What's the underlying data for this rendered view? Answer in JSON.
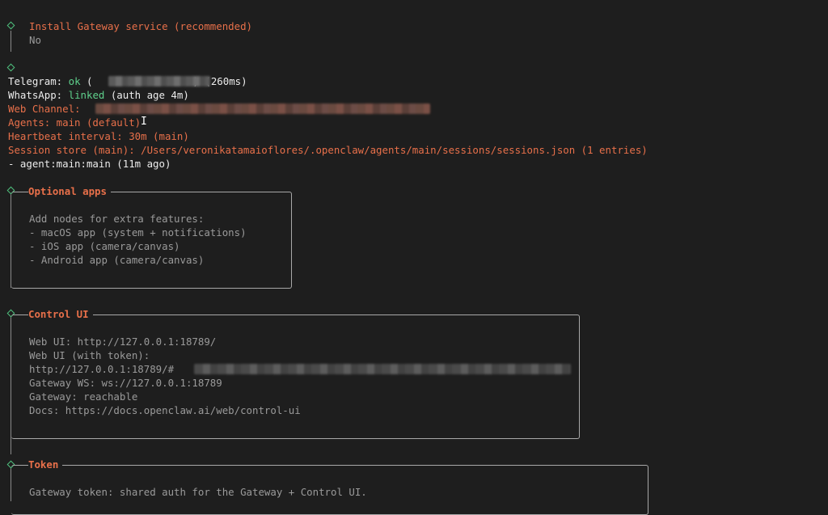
{
  "install": {
    "title": "Install Gateway service (recommended)",
    "value": "No"
  },
  "status": {
    "telegram_label": "Telegram: ",
    "telegram_status": "ok",
    "telegram_open": " (",
    "telegram_close": ") (260ms)",
    "whatsapp_label": "WhatsApp: ",
    "whatsapp_status": "linked",
    "whatsapp_detail": " (auth age 4m)",
    "web_channel": "Web Channel:",
    "agents": "Agents: main (default)",
    "heartbeat": "Heartbeat interval: 30m (main)",
    "session_store": "Session store (main): /Users/veronikatamaioflores/.openclaw/agents/main/sessions/sessions.json (1 entries)",
    "agent_line": "- agent:main:main (11m ago)"
  },
  "optional_apps": {
    "title": "Optional apps",
    "lines": [
      "Add nodes for extra features:",
      "- macOS app (system + notifications)",
      "- iOS app (camera/canvas)",
      "- Android app (camera/canvas)"
    ]
  },
  "control_ui": {
    "title": "Control UI",
    "lines": [
      "Web UI: http://127.0.0.1:18789/",
      "Web UI (with token):",
      "http://127.0.0.1:18789/#",
      "Gateway WS: ws://127.0.0.1:18789",
      "Gateway: reachable",
      "Docs: https://docs.openclaw.ai/web/control-ui"
    ]
  },
  "token": {
    "title": "Token",
    "lines": [
      "Gateway token: shared auth for the Gateway + Control UI."
    ]
  },
  "colors": {
    "background": "#1e1e1e",
    "accent_orange": "#e8704a",
    "accent_green": "#5fd08c",
    "diamond_green": "#4fc27e"
  }
}
